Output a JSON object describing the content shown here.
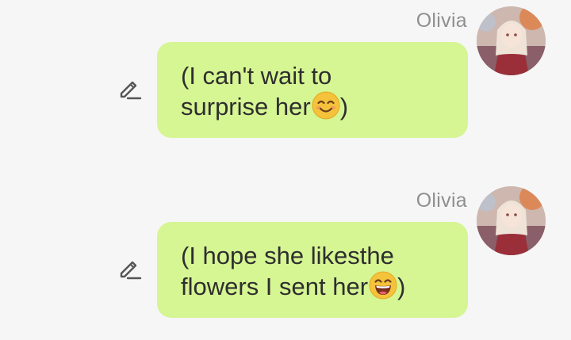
{
  "messages": [
    {
      "sender": "Olivia",
      "line1": "(I can't wait to",
      "line2_text": "surprise her",
      "emoji": "smiling-face-with-smiling-eyes",
      "line2_end": ")"
    },
    {
      "sender": "Olivia",
      "line1": "(I hope she likesthe",
      "line2_text": "flowers I sent her",
      "emoji": "grinning-face-with-smiling-eyes",
      "line2_end": ")"
    }
  ],
  "colors": {
    "bubble": "#d6f593",
    "sender": "#8f8f8f",
    "text": "#2e2e2e",
    "background": "#f6f6f6"
  }
}
